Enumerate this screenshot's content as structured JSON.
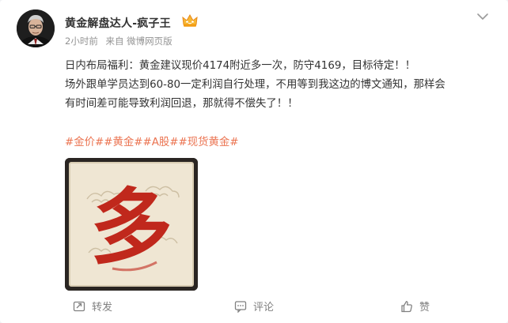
{
  "post": {
    "username": "黄金解盘达人-疯子王",
    "vip_badge_icon": "vip-crown-icon",
    "meta": {
      "time": "2小时前",
      "source": "来自 微博网页版"
    },
    "lines": [
      "日内布局福利：黄金建议现价4174附近多一次，防守4169，目标待定！！",
      "场外跟单学员达到60-80一定利润自行处理，不用等到我这边的博文通知，那样会",
      "有时间差可能导致利润回退，那就得不偿失了！！"
    ],
    "tags": [
      "#金价#",
      "#黄金#",
      "#A股#",
      "#现货黄金#"
    ],
    "image": {
      "character": "多"
    }
  },
  "actions": {
    "repost_label": "转发",
    "comment_label": "评论",
    "like_label": "赞"
  },
  "colors": {
    "accent": "#eb7350",
    "text": "#333333",
    "meta": "#939393",
    "brush_red": "#c0281c",
    "paper": "#efe6d3"
  }
}
